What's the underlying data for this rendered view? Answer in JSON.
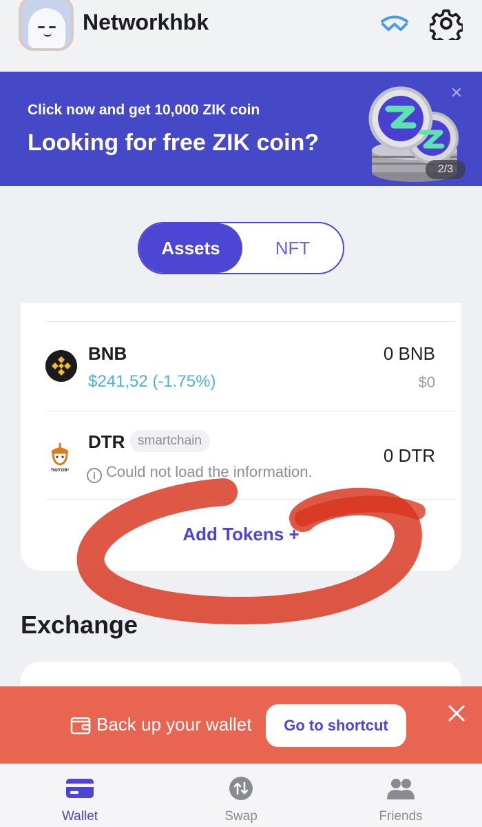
{
  "header": {
    "username": "Networkhbk",
    "icons": [
      "avatar",
      "walletconnect-icon",
      "gear-icon"
    ]
  },
  "banner": {
    "subtitle": "Click now and get 10,000 ZIK coin",
    "title": "Looking for free ZIK coin?",
    "page_indicator": "2/3",
    "close_label": "✕"
  },
  "tabs": {
    "assets": "Assets",
    "nft": "NFT",
    "selected": "Assets"
  },
  "tokens": [
    {
      "symbol": "BNB",
      "price": "$241,52 (-1.75%)",
      "amount": "0 BNB",
      "fiat": "$0",
      "icon": "bnb-icon"
    },
    {
      "symbol": "DTR",
      "chain": "smartchain",
      "error": "Could not load the information.",
      "amount": "0 DTR",
      "icon": "dotori-icon",
      "icon_caption": "DOTORI"
    }
  ],
  "add_tokens": "Add Tokens +",
  "exchange": {
    "title": "Exchange"
  },
  "backup": {
    "text": "Back up your wallet",
    "button": "Go to shortcut"
  },
  "nav": {
    "wallet": "Wallet",
    "swap": "Swap",
    "friends": "Friends",
    "active": "Wallet"
  },
  "colors": {
    "accent": "#4d45d3",
    "banner_bg": "#4548c7",
    "backup_bg": "#e86552",
    "price_blue": "#4ab2dd",
    "annotation_red": "#d8331c"
  }
}
